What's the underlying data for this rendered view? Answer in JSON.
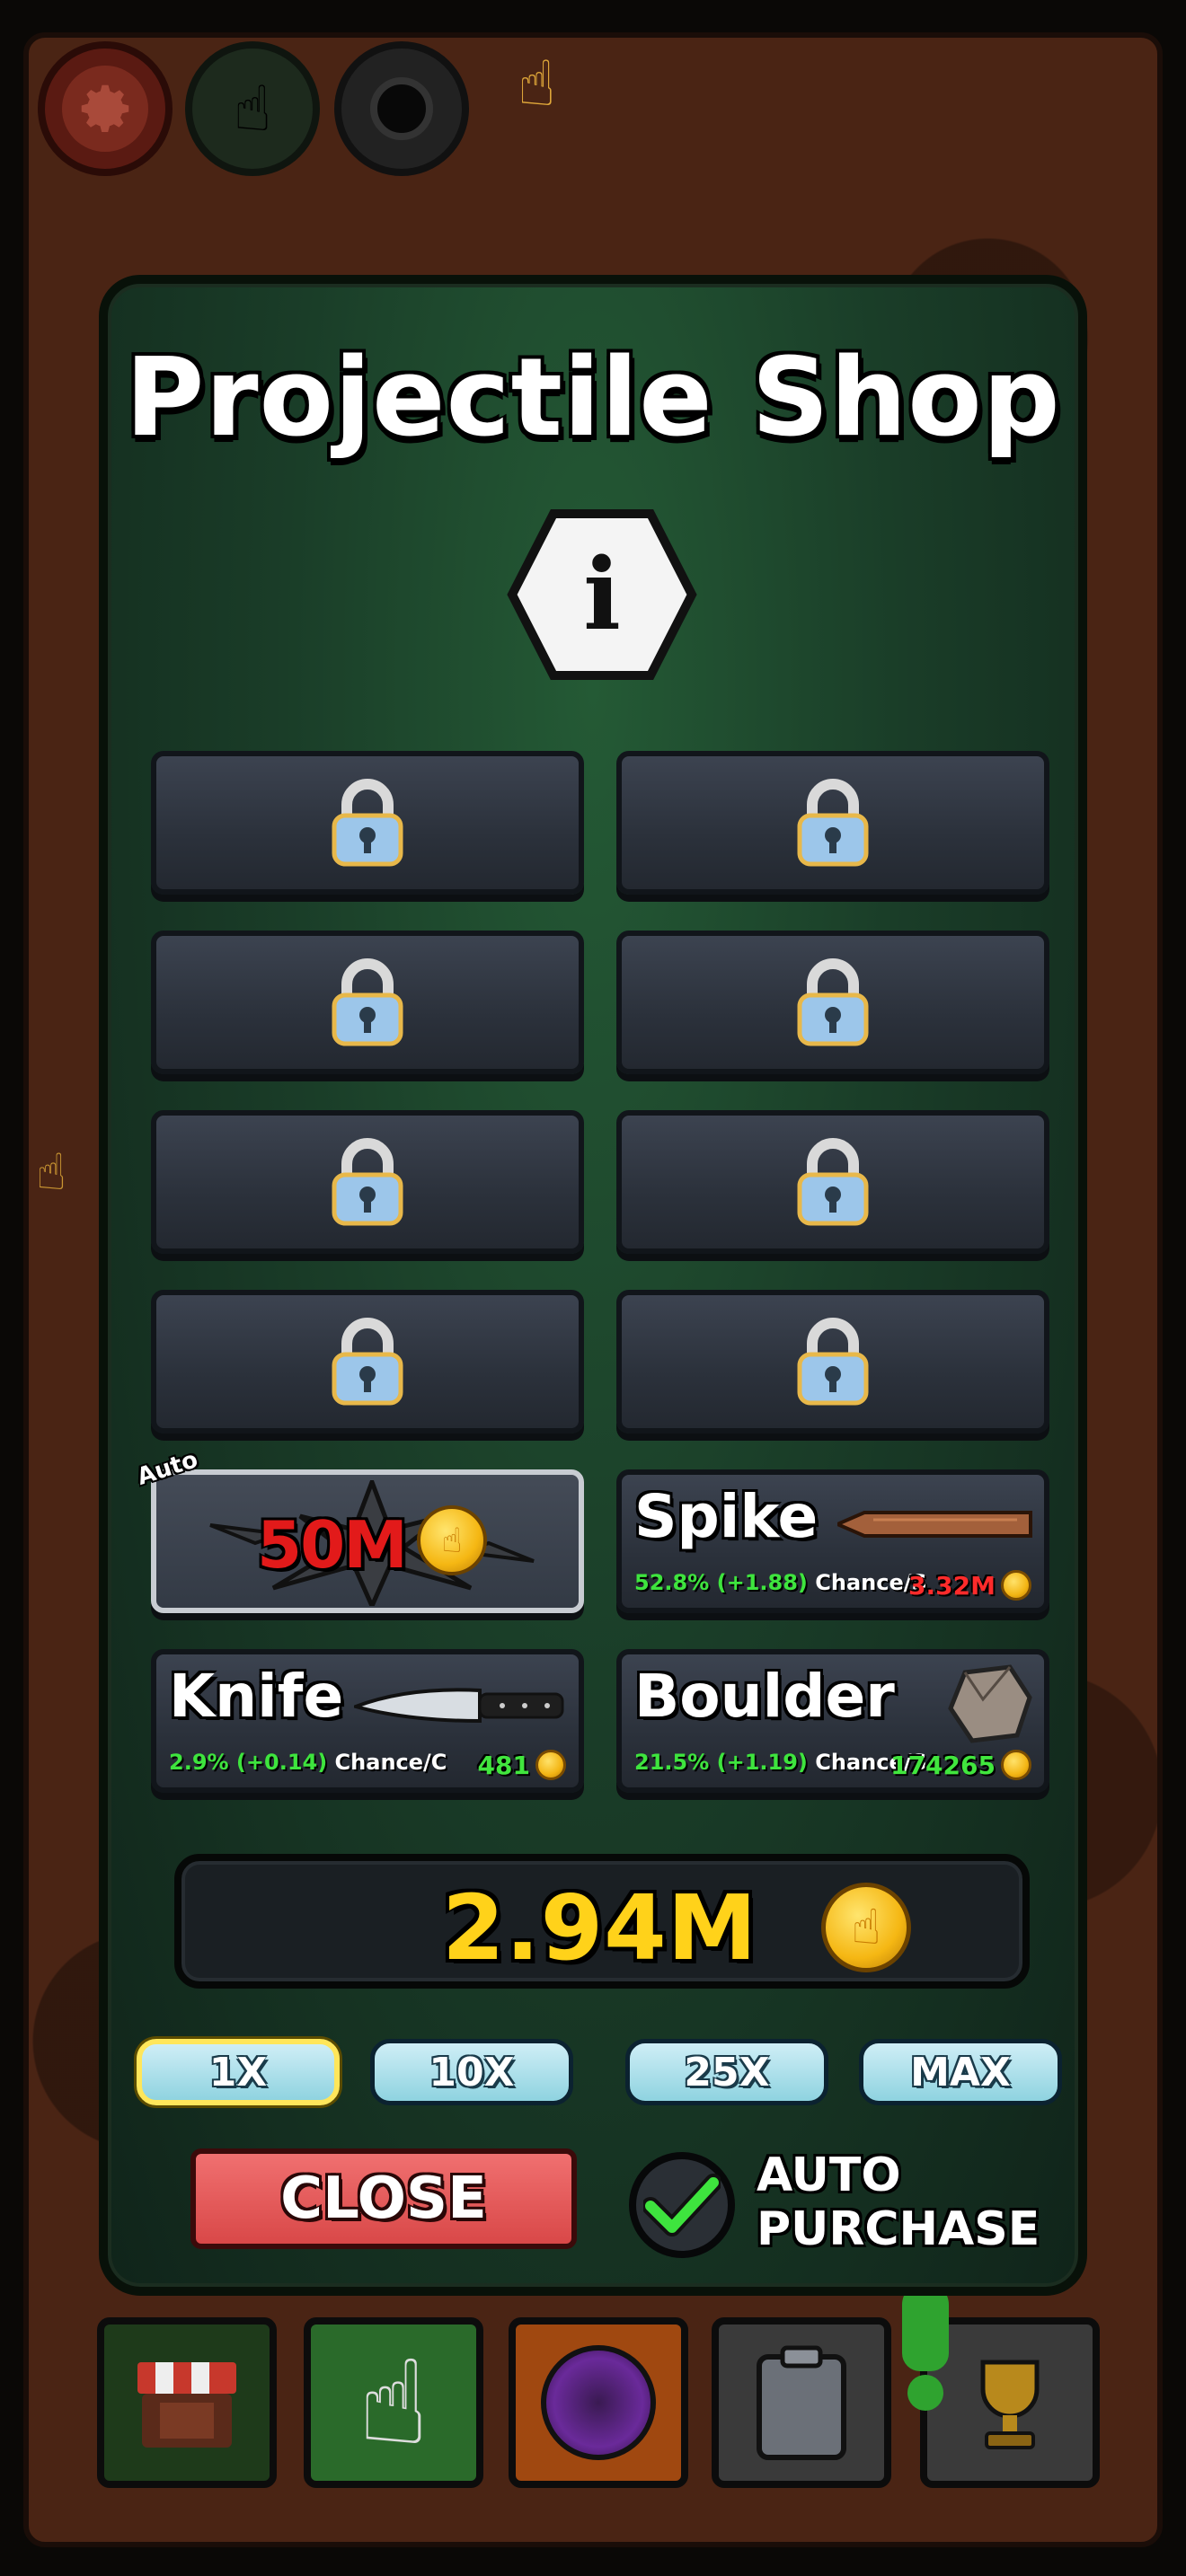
{
  "shop": {
    "title": "Projectile Shop",
    "info_label": "i"
  },
  "locked_slots": [
    {
      "state": "locked"
    },
    {
      "state": "locked"
    },
    {
      "state": "locked"
    },
    {
      "state": "locked"
    },
    {
      "state": "locked"
    },
    {
      "state": "locked"
    },
    {
      "state": "locked"
    },
    {
      "state": "locked"
    }
  ],
  "auto_slot": {
    "tag": "Auto",
    "price": "50M",
    "icon": "shuriken-icon"
  },
  "projectiles": [
    {
      "name": "Spike",
      "chance": "52.8% (+1.88)",
      "chance_unit": "Chance/S",
      "price": "3.32M",
      "price_color": "#ff2b2b",
      "icon": "wooden-stake-icon"
    },
    {
      "name": "Knife",
      "chance": "2.9% (+0.14)",
      "chance_unit": "Chance/C",
      "price": "481",
      "price_color": "#41e63e",
      "icon": "knife-icon"
    },
    {
      "name": "Boulder",
      "chance": "21.5% (+1.19)",
      "chance_unit": "Chance/S",
      "price": "174265",
      "price_color": "#41e63e",
      "icon": "boulder-icon"
    }
  ],
  "balance": {
    "amount": "2.94M",
    "icon": "coin-icon"
  },
  "multipliers": [
    {
      "label": "1X",
      "selected": true
    },
    {
      "label": "10X",
      "selected": false
    },
    {
      "label": "25X",
      "selected": false
    },
    {
      "label": "MAX",
      "selected": false
    }
  ],
  "actions": {
    "close_label": "CLOSE",
    "auto_purchase_line1": "AUTO",
    "auto_purchase_line2": "PURCHASE",
    "auto_purchase_checked": true
  },
  "colors": {
    "accent_gold": "#ffd21a",
    "close_red": "#d94848",
    "multiplier_blue": "#8fd3e0",
    "check_green": "#3ee43e"
  }
}
